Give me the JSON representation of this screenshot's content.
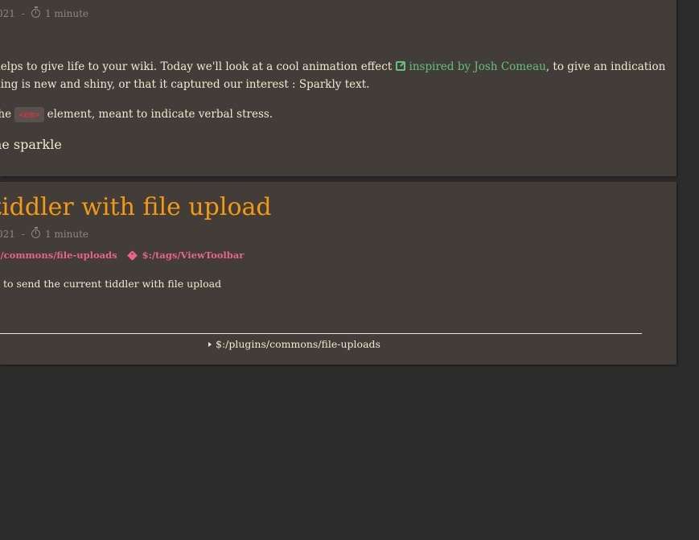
{
  "tiddler1": {
    "title_fragment": "…",
    "meta": {
      "date_fragment": "021",
      "separator": "-",
      "read_time": "1 minute"
    },
    "para1_prefix": "helps to give life to your wiki. Today we'll look at a cool animation effect",
    "para1_link": "inspired by Josh Comeau",
    "para1_suffix": ", to give an indication",
    "para2": "hing is new and shiny, or that it captured our interest : Sparkly text.",
    "para3_prefix": "the",
    "para3_code": "<em>",
    "para3_suffix": "element, meant to indicate verbal stress.",
    "heading": "he sparkle"
  },
  "tiddler2": {
    "title": "tiddler with file upload",
    "meta": {
      "date_fragment": "021",
      "separator": "-",
      "read_time": "1 minute"
    },
    "tags": [
      "s/commons/file-uploads",
      "$:/tags/ViewToolbar"
    ],
    "para": "n to send the current tiddler with file upload",
    "plugin_link": "$:/plugins/commons/file-uploads"
  },
  "colors": {
    "background": "#2d2c2c",
    "card": "#433d39",
    "title": "#f59a0f",
    "text": "#f2e8cf",
    "meta": "#8e8780",
    "link": "#5fc27a",
    "tag": "#e9638a",
    "code": "#e8303e"
  },
  "icons": [
    "clock-icon",
    "external-link-icon",
    "tag-icon",
    "disclosure-triangle-icon"
  ]
}
